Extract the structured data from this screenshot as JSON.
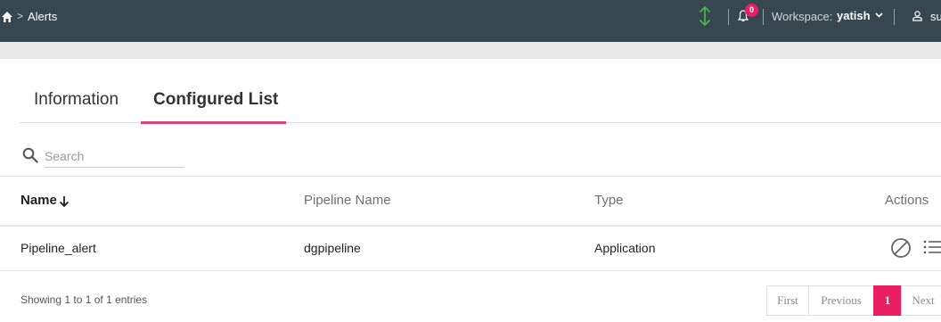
{
  "topbar": {
    "breadcrumb_separator": ">",
    "breadcrumb_label": "Alerts",
    "notification_count": "0",
    "workspace_label": "Workspace:",
    "workspace_value": "yatish",
    "user_name": "su",
    "icons": {
      "home": "home-icon",
      "sync": "sync-icon",
      "bell": "bell-icon",
      "caret": "chevron-down-icon",
      "user": "user-icon"
    },
    "sync_color": "#4caf50"
  },
  "tabs": [
    {
      "label": "Information",
      "active": false
    },
    {
      "label": "Configured List",
      "active": true
    }
  ],
  "accent_color": "#e91e63",
  "search": {
    "placeholder": "Search",
    "value": ""
  },
  "table": {
    "headers": {
      "name": "Name",
      "pipeline": "Pipeline Name",
      "type": "Type",
      "actions": "Actions"
    },
    "sort": {
      "column": "Name",
      "direction": "descending"
    },
    "rows": [
      {
        "name": "Pipeline_alert",
        "pipeline": "dgpipeline",
        "type": "Application",
        "actions": [
          "disable-icon",
          "list-icon"
        ]
      }
    ]
  },
  "footer": {
    "entries_text": "Showing 1 to 1 of 1 entries",
    "pagination": {
      "first": "First",
      "previous": "Previous",
      "current": "1",
      "next": "Next"
    }
  }
}
